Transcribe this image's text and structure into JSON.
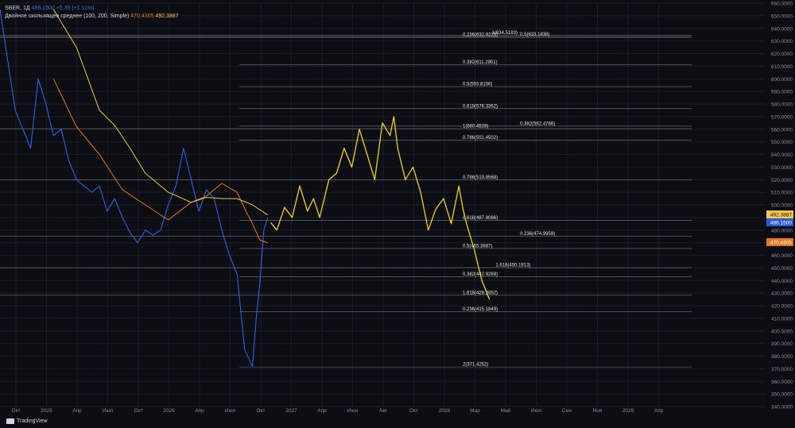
{
  "legend": {
    "symbol": "SBER, 1Д",
    "values": "486.1500 +5.35 (+1.11%)",
    "ma_label": "Двойное скользящее среднее (100, 200, Simple)",
    "ma1_value": "470.4305",
    "ma2_value": "492.3887"
  },
  "branding": {
    "name": "TradingView"
  },
  "colors": {
    "background": "#0c0e13",
    "price": "#2f5ad6",
    "ma_fast": "#e07b22",
    "ma_slow": "#f2c94c",
    "projection": "#f0d21a",
    "fib": "#ffffff"
  },
  "chart_data": {
    "type": "line",
    "ylim": [
      340,
      660
    ],
    "y_ticks": [
      "340.0000",
      "350.0000",
      "360.0000",
      "370.0000",
      "380.0000",
      "390.0000",
      "400.0000",
      "410.0000",
      "420.0000",
      "430.0000",
      "440.0000",
      "450.0000",
      "460.0000",
      "470.0000",
      "480.0000",
      "490.0000",
      "500.0000",
      "510.0000",
      "520.0000",
      "530.0000",
      "540.0000",
      "550.0000",
      "560.0000",
      "570.0000",
      "580.0000",
      "590.0000",
      "600.0000",
      "610.0000",
      "620.0000",
      "630.0000",
      "640.0000",
      "650.0000",
      "660.0000"
    ],
    "x_ticks": [
      "Окт",
      "2025",
      "Апр",
      "Июл",
      "Окт",
      "2026",
      "Апр",
      "Июл",
      "Окт",
      "2027",
      "Апр",
      "Июн",
      "Авг",
      "Окт",
      "2028",
      "Мар",
      "Май",
      "Июл",
      "Сен",
      "Ноя",
      "2029",
      "Апр"
    ],
    "price_badges": [
      {
        "label": "492.3887",
        "value": 492.3887,
        "color": "#f2c94c"
      },
      {
        "label": "486.1500",
        "value": 486.15,
        "color": "#2f5ad6"
      },
      {
        "label": "470.4305",
        "value": 470.4305,
        "color": "#e07b22"
      }
    ],
    "series": [
      {
        "kind": "price",
        "x": [
          0,
          0.01,
          0.02,
          0.03,
          0.04,
          0.05,
          0.06,
          0.07,
          0.08,
          0.09,
          0.1,
          0.11,
          0.12,
          0.13,
          0.14,
          0.15,
          0.16,
          0.17,
          0.18,
          0.19,
          0.2,
          0.21,
          0.22,
          0.23,
          0.24,
          0.25,
          0.26,
          0.27,
          0.28,
          0.29,
          0.3,
          0.31,
          0.32,
          0.33,
          0.335,
          0.34,
          0.345,
          0.35
        ],
        "values": [
          655,
          615,
          575,
          560,
          545,
          600,
          580,
          555,
          560,
          535,
          520,
          515,
          510,
          515,
          495,
          505,
          490,
          478,
          470,
          480,
          476,
          480,
          500,
          515,
          545,
          520,
          495,
          512,
          505,
          480,
          460,
          445,
          385,
          372,
          410,
          440,
          480,
          490
        ]
      },
      {
        "kind": "ma_fast",
        "x": [
          0.07,
          0.1,
          0.13,
          0.16,
          0.19,
          0.22,
          0.25,
          0.27,
          0.29,
          0.31,
          0.32,
          0.33,
          0.34,
          0.35
        ],
        "values": [
          600,
          562,
          540,
          512,
          500,
          488,
          502,
          507,
          517,
          510,
          497,
          485,
          472,
          470
        ]
      },
      {
        "kind": "ma_slow",
        "x": [
          0.07,
          0.1,
          0.13,
          0.15,
          0.17,
          0.19,
          0.22,
          0.25,
          0.27,
          0.29,
          0.31,
          0.33,
          0.35
        ],
        "values": [
          655,
          625,
          575,
          563,
          545,
          525,
          510,
          502,
          506,
          505,
          505,
          500,
          492
        ]
      },
      {
        "kind": "projection",
        "x": [
          0.354,
          0.362,
          0.372,
          0.382,
          0.392,
          0.402,
          0.41,
          0.418,
          0.43,
          0.44,
          0.45,
          0.46,
          0.47,
          0.48,
          0.49,
          0.5,
          0.51,
          0.515,
          0.52,
          0.53,
          0.54,
          0.55,
          0.56,
          0.57,
          0.58,
          0.59,
          0.6,
          0.605,
          0.61,
          0.615,
          0.62,
          0.63,
          0.64
        ],
        "values": [
          486,
          480,
          498,
          490,
          515,
          495,
          505,
          490,
          520,
          525,
          545,
          530,
          560,
          540,
          520,
          565,
          555,
          570,
          545,
          520,
          530,
          510,
          480,
          497,
          505,
          485,
          515,
          498,
          485,
          475,
          465,
          440,
          425
        ]
      }
    ],
    "fib_levels": [
      {
        "label": "0.236(632.9222)",
        "value": 632.9222,
        "x_start": 0.0,
        "label_x": 0.605
      },
      {
        "label": "1(634.5183)",
        "value": 634.5183,
        "x_start": 0.0,
        "label_x": 0.643
      },
      {
        "label": "0.5(633.1838)",
        "value": 633.1838,
        "x_start": 0.0,
        "label_x": 0.68
      },
      {
        "label": "0.382(611.2951)",
        "value": 611.2951,
        "x_start": 0.313,
        "label_x": 0.605
      },
      {
        "label": "0.5(593.8156)",
        "value": 593.8156,
        "x_start": 0.313,
        "label_x": 0.605
      },
      {
        "label": "0.618(576.3362)",
        "value": 576.3362,
        "x_start": 0.313,
        "label_x": 0.605
      },
      {
        "label": "1(560.4528)",
        "value": 560.4528,
        "x_start": 0.0,
        "label_x": 0.605
      },
      {
        "label": "0.382(562.4786)",
        "value": 562.4786,
        "x_start": 0.313,
        "label_x": 0.68
      },
      {
        "label": "0.786(551.4502)",
        "value": 551.4502,
        "x_start": 0.313,
        "label_x": 0.605
      },
      {
        "label": "0.786(519.8568)",
        "value": 519.8568,
        "x_start": 0.0,
        "label_x": 0.605
      },
      {
        "label": "0.618(487.8086)",
        "value": 487.8086,
        "x_start": 0.313,
        "label_x": 0.605
      },
      {
        "label": "0.236(474.9959)",
        "value": 474.9959,
        "x_start": 0.0,
        "label_x": 0.68
      },
      {
        "label": "0.5(465.3687)",
        "value": 465.3687,
        "x_start": 0.313,
        "label_x": 0.605
      },
      {
        "label": "1.618(450.1913)",
        "value": 450.1913,
        "x_start": 0.0,
        "label_x": 0.648
      },
      {
        "label": "0.382(442.9289)",
        "value": 442.9289,
        "x_start": 0.313,
        "label_x": 0.605
      },
      {
        "label": "1.618(428.2852)",
        "value": 428.2852,
        "x_start": 0.0,
        "label_x": 0.605
      },
      {
        "label": "0.236(415.1849)",
        "value": 415.1849,
        "x_start": 0.313,
        "label_x": 0.605
      },
      {
        "label": "2(371.4252)",
        "value": 371.4252,
        "x_start": 0.313,
        "label_x": 0.605
      }
    ]
  }
}
